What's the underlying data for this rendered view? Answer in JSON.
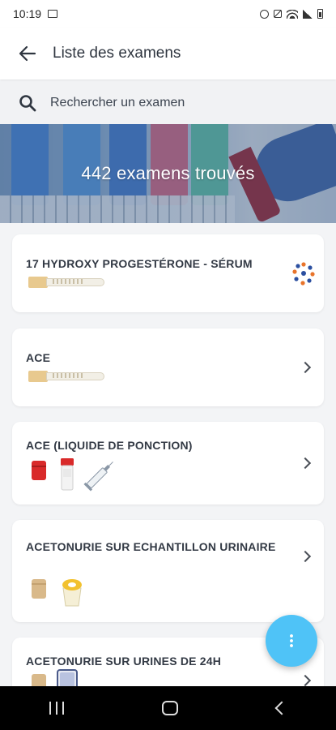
{
  "status_bar": {
    "time": "10:19",
    "icons": [
      "gallery-icon",
      "alarm-icon",
      "mute-icon",
      "wifi-icon",
      "signal-icon",
      "battery-icon"
    ]
  },
  "app_bar": {
    "title": "Liste des examens",
    "back_icon": "arrow-left-icon"
  },
  "search": {
    "placeholder": "Rechercher un examen",
    "value": ""
  },
  "banner": {
    "text": "442 examens trouvés"
  },
  "exams": [
    {
      "title": "17 HYDROXY PROGESTÉRONE - SÉRUM",
      "containers": [
        "beige-tube"
      ],
      "trailing": "lab-logo-icon"
    },
    {
      "title": "ACE",
      "containers": [
        "beige-tube"
      ],
      "trailing": "chevron-right-icon"
    },
    {
      "title": "ACE (LIQUIDE DE PONCTION)",
      "containers": [
        "red-cap-pot",
        "red-cap-tube",
        "syringe"
      ],
      "trailing": "chevron-right-icon"
    },
    {
      "title": "ACETONURIE SUR ECHANTILLON URINAIRE",
      "containers": [
        "beige-pot",
        "yellow-urine-cup"
      ],
      "trailing": "chevron-right-icon"
    },
    {
      "title": "ACETONURIE SUR URINES DE 24H",
      "containers": [
        "beige-pot",
        "urine-container-24h"
      ],
      "trailing": "chevron-right-icon"
    }
  ],
  "fab": {
    "icon": "more-vertical-icon"
  },
  "colors": {
    "accent": "#4fc3f7",
    "background": "#f3f4f6",
    "card": "#ffffff",
    "text": "#333a45"
  }
}
